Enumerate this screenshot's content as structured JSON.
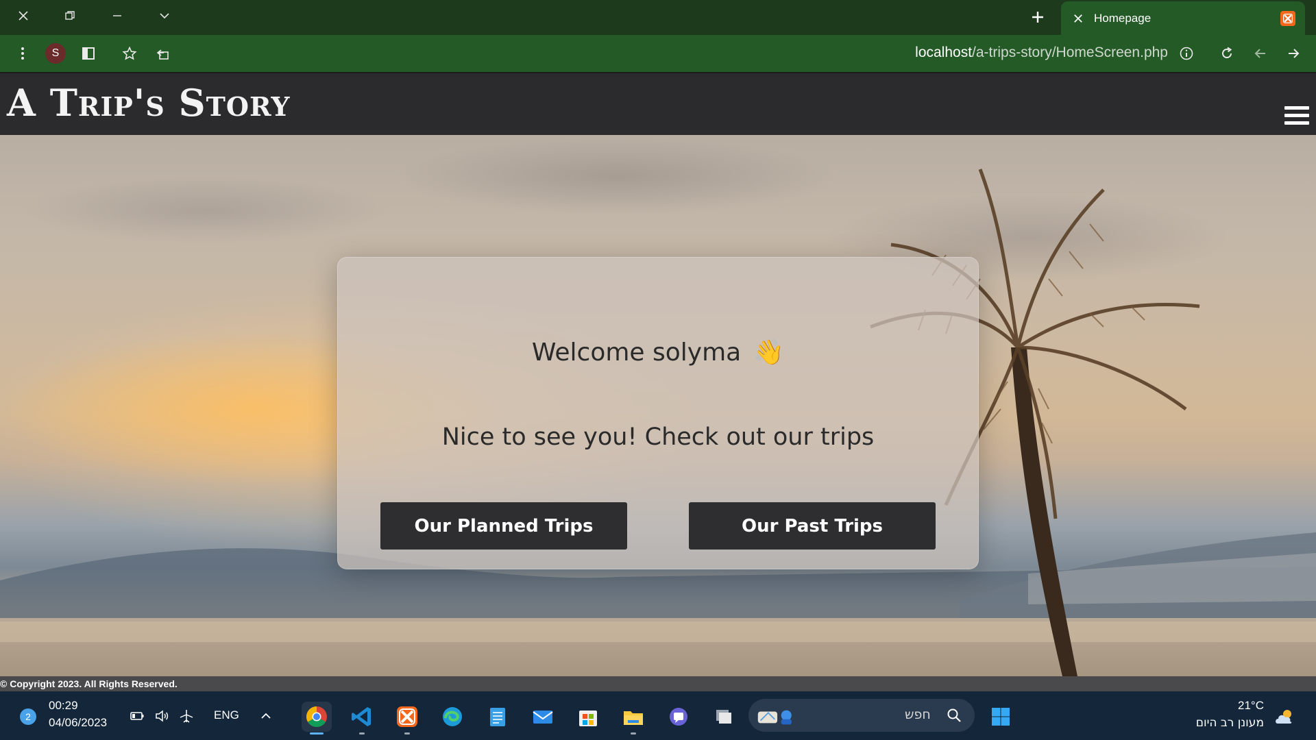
{
  "browser": {
    "tab": {
      "title": "Homepage"
    },
    "profile_initial": "S",
    "url": {
      "host": "localhost",
      "path": "/a-trips-story/HomeScreen.php"
    }
  },
  "site": {
    "logo": "A Trip's Story",
    "welcome": "Welcome solyma",
    "wave_emoji": "👋",
    "tagline": "Nice to see you! Check out our trips",
    "buttons": {
      "planned": "Our Planned Trips",
      "past": "Our Past Trips"
    },
    "footer": "© Copyright 2023. All Rights Reserved."
  },
  "taskbar": {
    "notification_count": "2",
    "time": "00:29",
    "date": "04/06/2023",
    "language": "ENG",
    "search_placeholder": "חפש",
    "weather": {
      "temp": "21°C",
      "description": "מעונן רב היום"
    },
    "apps": [
      "chrome-icon",
      "vscode-icon",
      "xampp-icon",
      "edge-icon",
      "notepad-icon",
      "mail-icon",
      "store-icon",
      "file-explorer-icon",
      "teams-chat-icon",
      "task-view-icon"
    ]
  },
  "colors": {
    "tab_strip": "#1e3a1c",
    "toolbar": "#245a26",
    "site_header": "#2b2a2c",
    "button_bg": "#2e2d2f",
    "taskbar": "#13263a"
  }
}
